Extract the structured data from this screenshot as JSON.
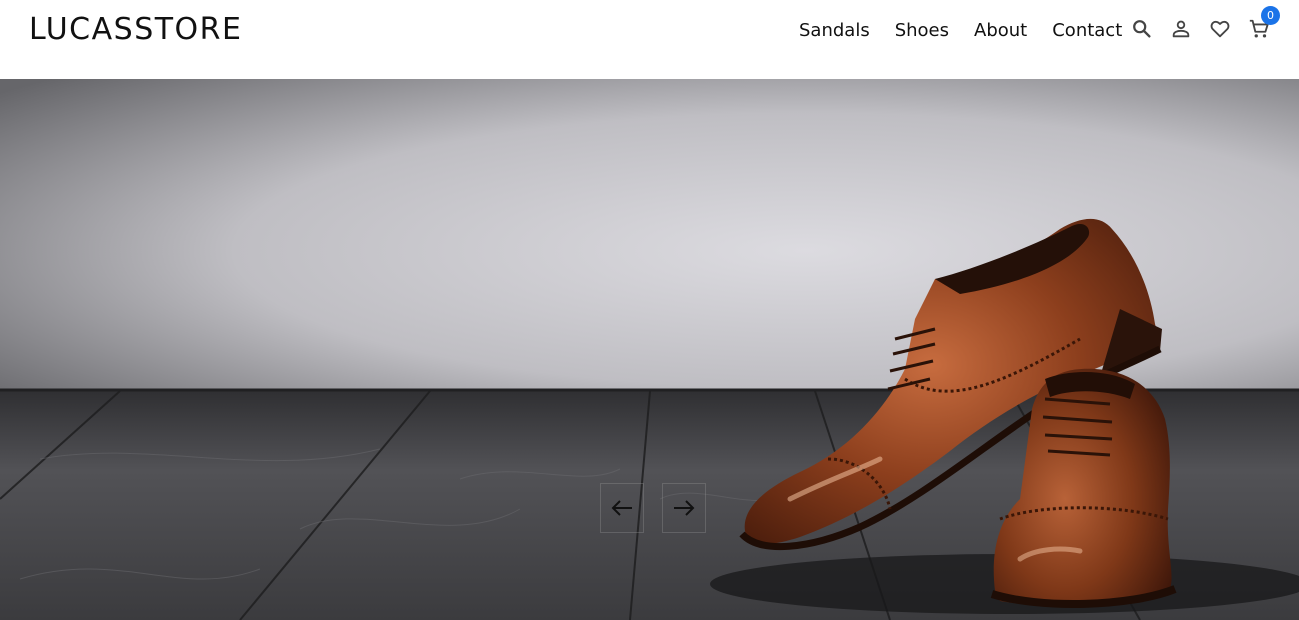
{
  "brand": {
    "name": "LUCASSTORE"
  },
  "nav": {
    "items": [
      {
        "label": "Sandals"
      },
      {
        "label": "Shoes"
      },
      {
        "label": "About"
      },
      {
        "label": "Contact"
      }
    ]
  },
  "header_icons": {
    "search": "search-icon",
    "account": "user-icon",
    "wishlist": "heart-icon",
    "cart": "cart-icon",
    "cart_count": "0"
  },
  "slider": {
    "prev_icon": "arrow-left-icon",
    "next_icon": "arrow-right-icon"
  },
  "colors": {
    "badge": "#1a73e8",
    "leather": "#8a3e1c",
    "wall": "#c9c8cd",
    "floor": "#3a3a3d"
  }
}
